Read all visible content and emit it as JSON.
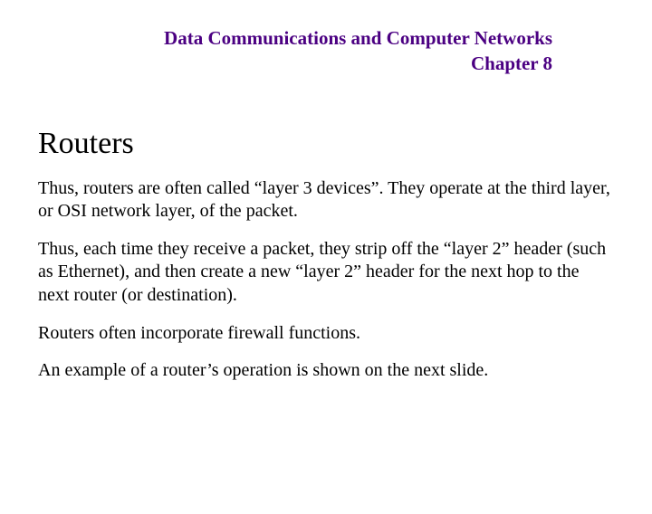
{
  "header": {
    "course_title": "Data Communications and Computer Networks",
    "chapter": "Chapter 8"
  },
  "section": {
    "title": "Routers",
    "paragraphs": [
      "Thus, routers are often called “layer 3 devices”.  They operate at the third layer, or OSI network layer, of the packet.",
      "Thus, each time they receive a packet, they strip off the “layer 2” header (such as Ethernet), and then create a new “layer 2” header for the next hop to the next router (or destination).",
      "Routers often incorporate firewall functions.",
      "An example of a router’s operation is shown on the next slide."
    ]
  }
}
